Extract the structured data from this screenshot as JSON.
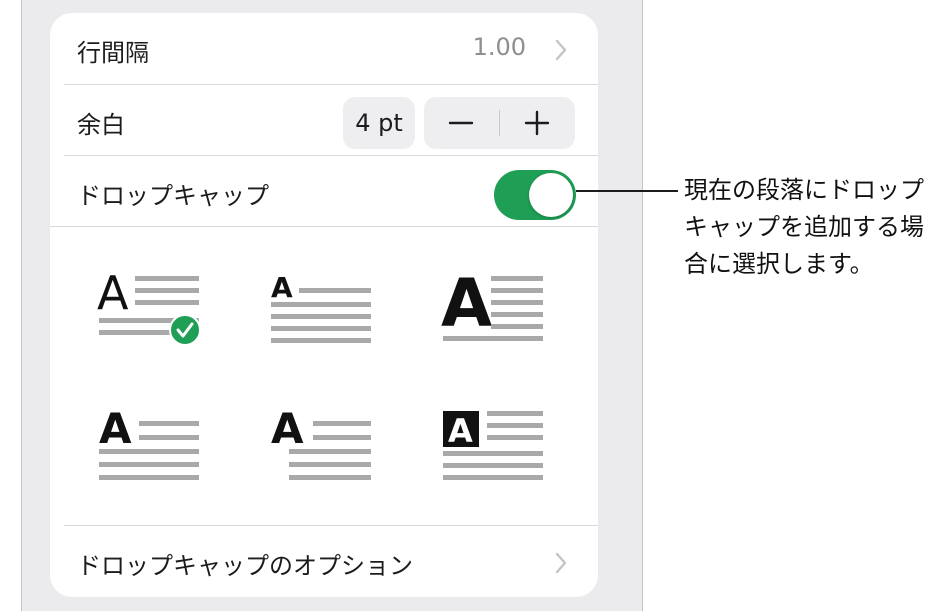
{
  "settings": {
    "line_spacing": {
      "label": "行間隔",
      "value": "1.00"
    },
    "padding": {
      "label": "余白",
      "value": "4 pt",
      "decrement_symbol": "−",
      "increment_symbol": "+"
    },
    "drop_cap": {
      "label": "ドロップキャップ",
      "enabled": true
    },
    "drop_cap_styles": [
      {
        "style": "plain-A-lines-below",
        "selected": true
      },
      {
        "style": "small-bold-A-raised"
      },
      {
        "style": "large-black-A-three-lines"
      },
      {
        "style": "bold-A-lines-below"
      },
      {
        "style": "bold-A-indented-lines"
      },
      {
        "style": "reversed-A-box"
      }
    ],
    "options": {
      "label": "ドロップキャップのオプション"
    }
  },
  "callout": {
    "text": "現在の段落にドロップキャップを追加する場合に選択します。"
  },
  "colors": {
    "toggle_on": "#1f9f55",
    "checkmark": "#1f9f55",
    "line_gray": "#a9a9a9",
    "panel_bg": "#ebebed"
  },
  "icons": {
    "chevron": "chevron-right-icon",
    "check": "checkmark-icon"
  }
}
